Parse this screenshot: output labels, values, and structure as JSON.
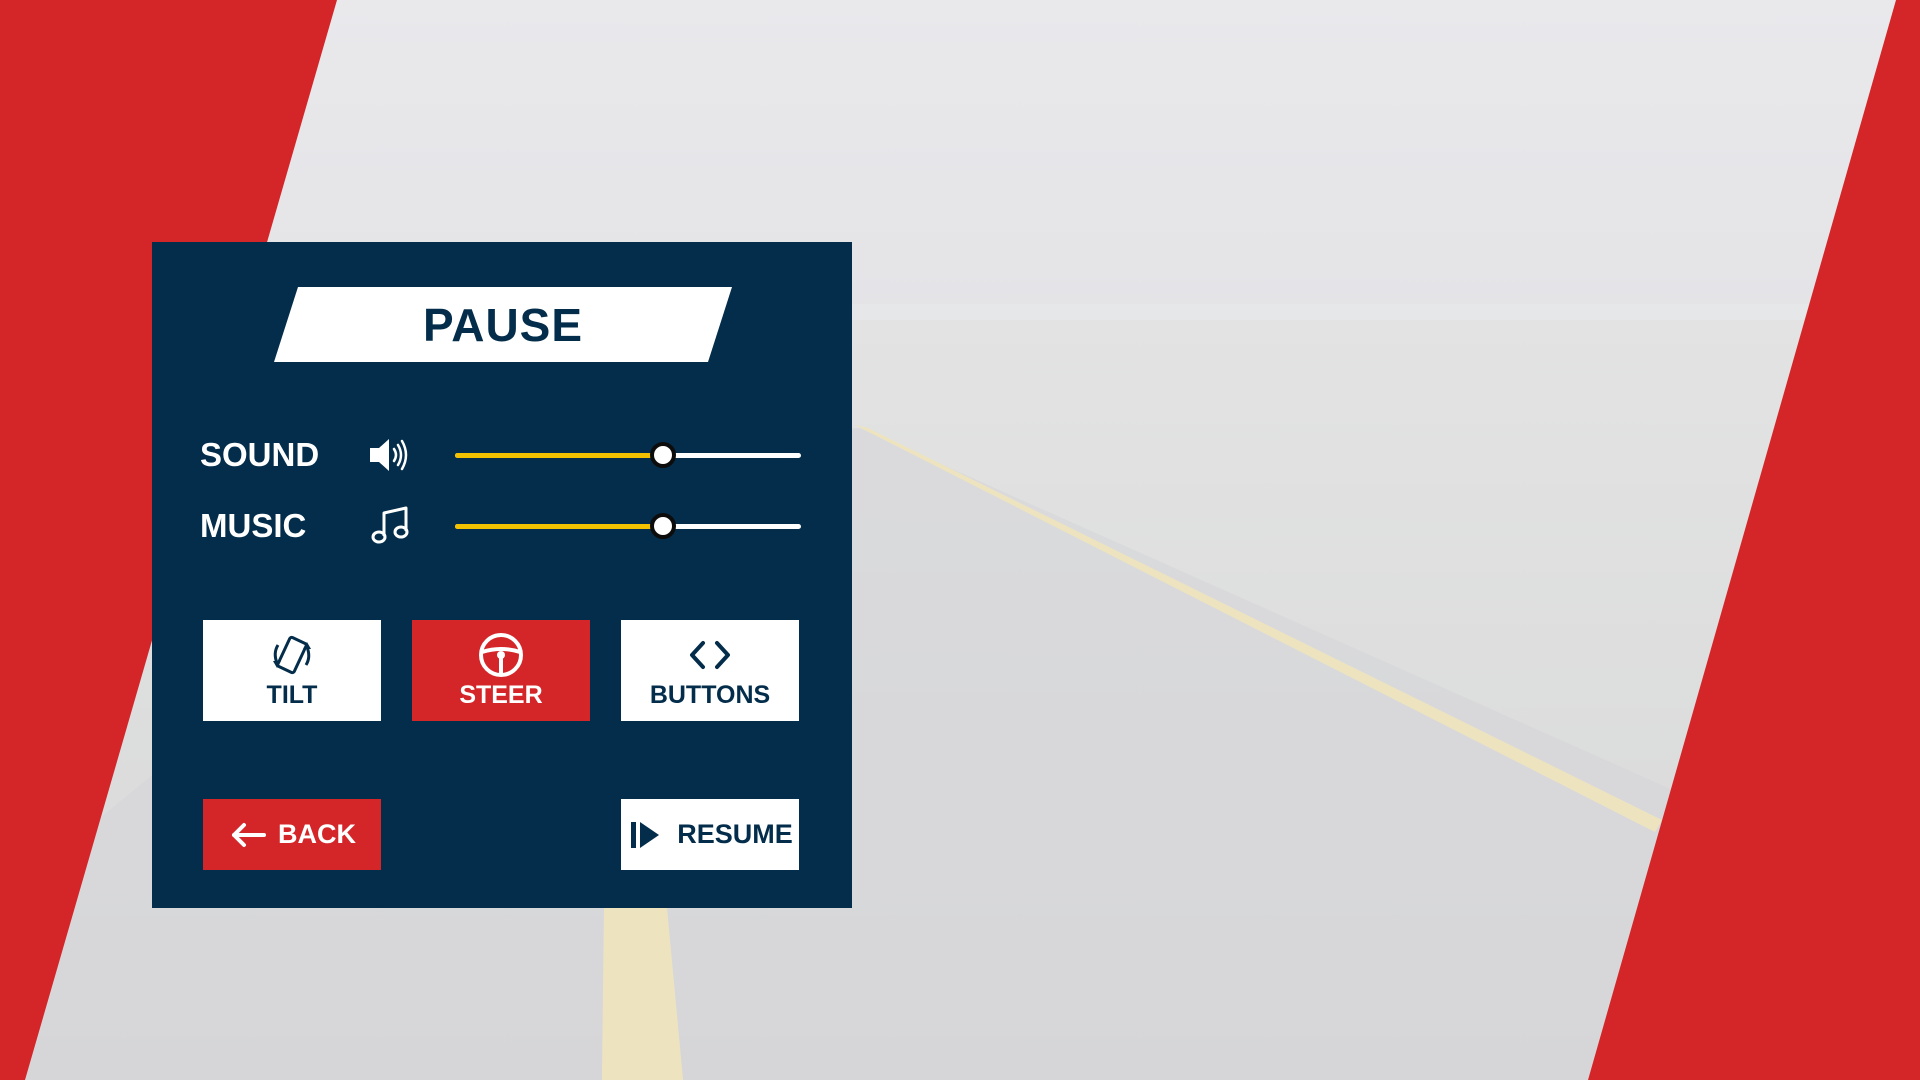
{
  "colors": {
    "panel": "#032d4a",
    "accent_red": "#d42629",
    "slider_fill": "#f2c200",
    "white": "#ffffff"
  },
  "pause_menu": {
    "title": "PAUSE",
    "sound": {
      "label": "SOUND",
      "icon": "speaker-icon",
      "level": 0.6
    },
    "music": {
      "label": "MUSIC",
      "icon": "music-note-icon",
      "level": 0.6
    },
    "control_modes": [
      {
        "label": "TILT",
        "icon": "tilt-phone-icon",
        "selected": false
      },
      {
        "label": "STEER",
        "icon": "steering-wheel-icon",
        "selected": true
      },
      {
        "label": "BUTTONS",
        "icon": "arrow-buttons-icon",
        "selected": false
      }
    ],
    "back": {
      "label": "BACK",
      "icon": "arrow-left-icon"
    },
    "resume": {
      "label": "RESUME",
      "icon": "play-resume-icon"
    }
  }
}
